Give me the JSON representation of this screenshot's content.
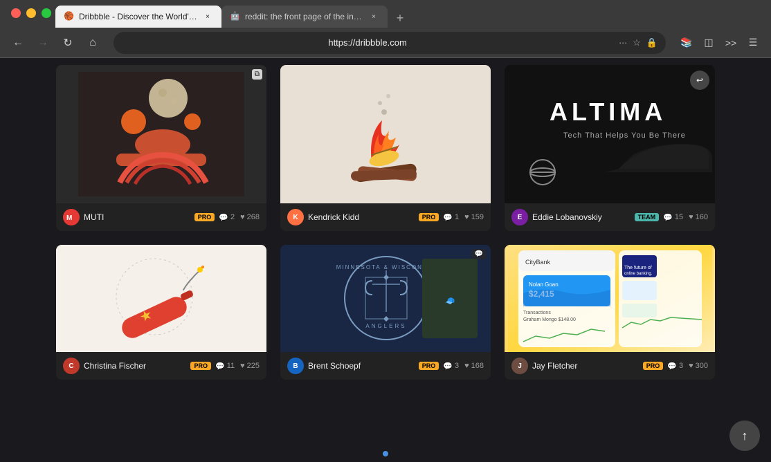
{
  "browser": {
    "tabs": [
      {
        "id": "tab-dribbble",
        "favicon": "🏀",
        "label": "Dribbble - Discover the World's Top Designers & Creativ...",
        "url": "https://dribbble.com",
        "active": true,
        "closeable": true
      },
      {
        "id": "tab-reddit",
        "favicon": "🤖",
        "label": "reddit: the front page of the internet",
        "url": "https://www.reddit.com",
        "active": false,
        "closeable": true
      }
    ],
    "address": "https://dribbble.com",
    "nav": {
      "back_disabled": false,
      "forward_disabled": false
    }
  },
  "cards": [
    {
      "id": "card-muti",
      "image_type": "muti",
      "avatar_color": "#e53935",
      "avatar_letter": "M",
      "author": "MUTI",
      "badge": "PRO",
      "badge_type": "pro",
      "comments": 2,
      "likes": 268,
      "has_multiwindow": true
    },
    {
      "id": "card-campfire",
      "image_type": "campfire",
      "avatar_color": "#ff7043",
      "avatar_letter": "K",
      "author": "Kendrick Kidd",
      "badge": "PRO",
      "badge_type": "pro",
      "comments": 1,
      "likes": 159
    },
    {
      "id": "card-altima",
      "image_type": "altima",
      "avatar_color": "#7b1fa2",
      "avatar_letter": "E",
      "author": "Eddie Lobanovskiy",
      "badge": "TEAM",
      "badge_type": "team",
      "comments": 15,
      "likes": 160,
      "has_reblog": true
    },
    {
      "id": "card-cannon",
      "image_type": "cannon",
      "avatar_color": "#c0392b",
      "avatar_letter": "C",
      "author": "Christina Fischer",
      "badge": "PRO",
      "badge_type": "pro",
      "comments": 11,
      "likes": 225
    },
    {
      "id": "card-anglers",
      "image_type": "anglers",
      "avatar_color": "#1565c0",
      "avatar_letter": "B",
      "author": "Brent Schoepf",
      "badge": "PRO",
      "badge_type": "pro",
      "comments": 3,
      "likes": 168,
      "has_comment_icon": true
    },
    {
      "id": "card-jay",
      "image_type": "jay",
      "avatar_color": "#6d4c41",
      "avatar_letter": "J",
      "author": "Jay Fletcher",
      "badge": "PRO",
      "badge_type": "pro",
      "comments": 3,
      "likes": 300
    }
  ],
  "bottom_cards": [
    {
      "id": "bottom-cannon",
      "image_type": "cannon",
      "author": "Christina Fischer",
      "badge": "PRO",
      "badge_type": "pro",
      "comments": 11,
      "likes": 225
    },
    {
      "id": "bottom-anglers",
      "image_type": "anglers_full",
      "author": "Brent Schoepf",
      "badge": "PRO",
      "badge_type": "pro",
      "comments": 3,
      "likes": 168
    },
    {
      "id": "bottom-hats",
      "image_type": "hats",
      "author": "Jay Fletcher",
      "badge": "PRO",
      "badge_type": "pro",
      "comments": 3,
      "likes": 300
    }
  ],
  "ui": {
    "back_to_top_label": "↑"
  }
}
